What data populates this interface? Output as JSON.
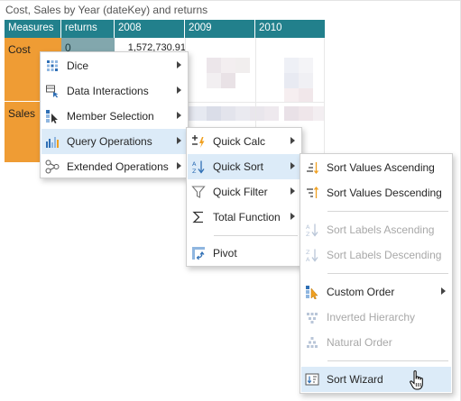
{
  "title": "Cost, Sales by Year (dateKey) and returns",
  "grid": {
    "headers": [
      "Measures",
      "returns",
      "2008",
      "2009",
      "2010"
    ],
    "rows": [
      {
        "label": "Cost",
        "returns": "0",
        "value_2008": "1,572,730.91"
      },
      {
        "label": "Sales",
        "returns": "",
        "value_2008": ""
      }
    ]
  },
  "menu_main": [
    {
      "label": "Dice",
      "icon": "dice-icon",
      "submenu": true
    },
    {
      "label": "Data Interactions",
      "icon": "data-interactions-icon",
      "submenu": true
    },
    {
      "label": "Member Selection",
      "icon": "member-selection-icon",
      "submenu": true
    },
    {
      "label": "Query Operations",
      "icon": "query-operations-icon",
      "submenu": true,
      "highlighted": true
    },
    {
      "label": "Extended Operations",
      "icon": "extended-operations-icon",
      "submenu": true
    }
  ],
  "menu_query": [
    {
      "label": "Quick Calc",
      "icon": "quick-calc-icon",
      "submenu": true
    },
    {
      "label": "Quick Sort",
      "icon": "quick-sort-icon",
      "submenu": true,
      "highlighted": true
    },
    {
      "label": "Quick Filter",
      "icon": "quick-filter-icon",
      "submenu": true
    },
    {
      "label": "Total Function",
      "icon": "sigma-icon",
      "submenu": true
    },
    {
      "label": "Pivot",
      "icon": "pivot-icon",
      "submenu": false
    }
  ],
  "menu_sort": [
    {
      "label": "Sort Values Ascending",
      "icon": "sort-values-ascending-icon",
      "enabled": true
    },
    {
      "label": "Sort Values Descending",
      "icon": "sort-values-descending-icon",
      "enabled": true
    },
    {
      "label": "Sort Labels Ascending",
      "icon": "sort-labels-ascending-icon",
      "enabled": false
    },
    {
      "label": "Sort Labels Descending",
      "icon": "sort-labels-descending-icon",
      "enabled": false
    },
    {
      "label": "Custom Order",
      "icon": "custom-order-icon",
      "enabled": true,
      "submenu": true
    },
    {
      "label": "Inverted Hierarchy",
      "icon": "inverted-hierarchy-icon",
      "enabled": false
    },
    {
      "label": "Natural Order",
      "icon": "natural-order-icon",
      "enabled": false
    },
    {
      "label": "Sort Wizard",
      "icon": "sort-wizard-icon",
      "enabled": true,
      "highlighted": true
    }
  ],
  "colors": {
    "header_teal": "#22808c",
    "row_orange": "#ef9c34",
    "highlight": "#dcebf8",
    "accent_orange": "#f0a020",
    "icon_blue": "#2f6fb5"
  }
}
